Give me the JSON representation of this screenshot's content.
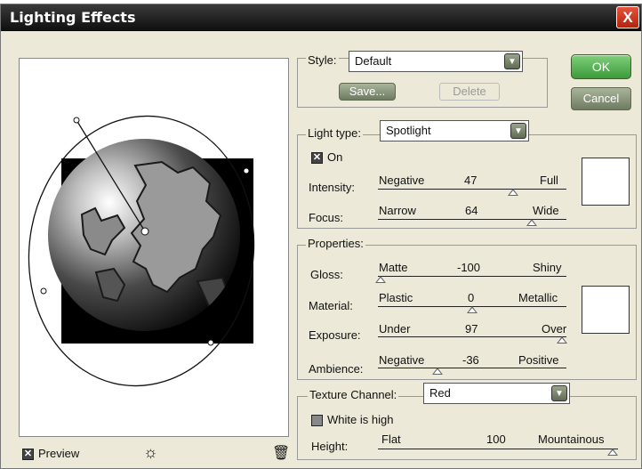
{
  "window": {
    "title": "Lighting Effects",
    "close_glyph": "X"
  },
  "buttons": {
    "ok": "OK",
    "cancel": "Cancel",
    "save": "Save...",
    "delete": "Delete"
  },
  "style": {
    "label": "Style:",
    "value": "Default"
  },
  "light_type": {
    "label": "Light type:",
    "value": "Spotlight",
    "on_label": "On",
    "on_checked": true,
    "intensity": {
      "label": "Intensity:",
      "left": "Negative",
      "value": "47",
      "right": "Full",
      "range": [
        -100,
        100
      ]
    },
    "focus": {
      "label": "Focus:",
      "left": "Narrow",
      "value": "64",
      "right": "Wide",
      "range": [
        -100,
        100
      ]
    },
    "color": "#ffffff"
  },
  "properties": {
    "label": "Properties:",
    "gloss": {
      "label": "Gloss:",
      "left": "Matte",
      "value": "-100",
      "right": "Shiny",
      "range": [
        -100,
        100
      ]
    },
    "material": {
      "label": "Material:",
      "left": "Plastic",
      "value": "0",
      "right": "Metallic",
      "range": [
        -100,
        100
      ]
    },
    "exposure": {
      "label": "Exposure:",
      "left": "Under",
      "value": "97",
      "right": "Over",
      "range": [
        -100,
        100
      ]
    },
    "ambience": {
      "label": "Ambience:",
      "left": "Negative",
      "value": "-36",
      "right": "Positive",
      "range": [
        -100,
        100
      ]
    },
    "color": "#ffffff"
  },
  "texture": {
    "label": "Texture Channel:",
    "value": "Red",
    "white_is_high_label": "White is high",
    "white_is_high_checked": false,
    "height": {
      "label": "Height:",
      "left": "Flat",
      "value": "100",
      "right": "Mountainous",
      "range": [
        0,
        100
      ]
    }
  },
  "preview": {
    "label": "Preview",
    "checked": true,
    "light_bulb_icon": "light-bulb-icon",
    "trash_icon": "trash-icon"
  }
}
